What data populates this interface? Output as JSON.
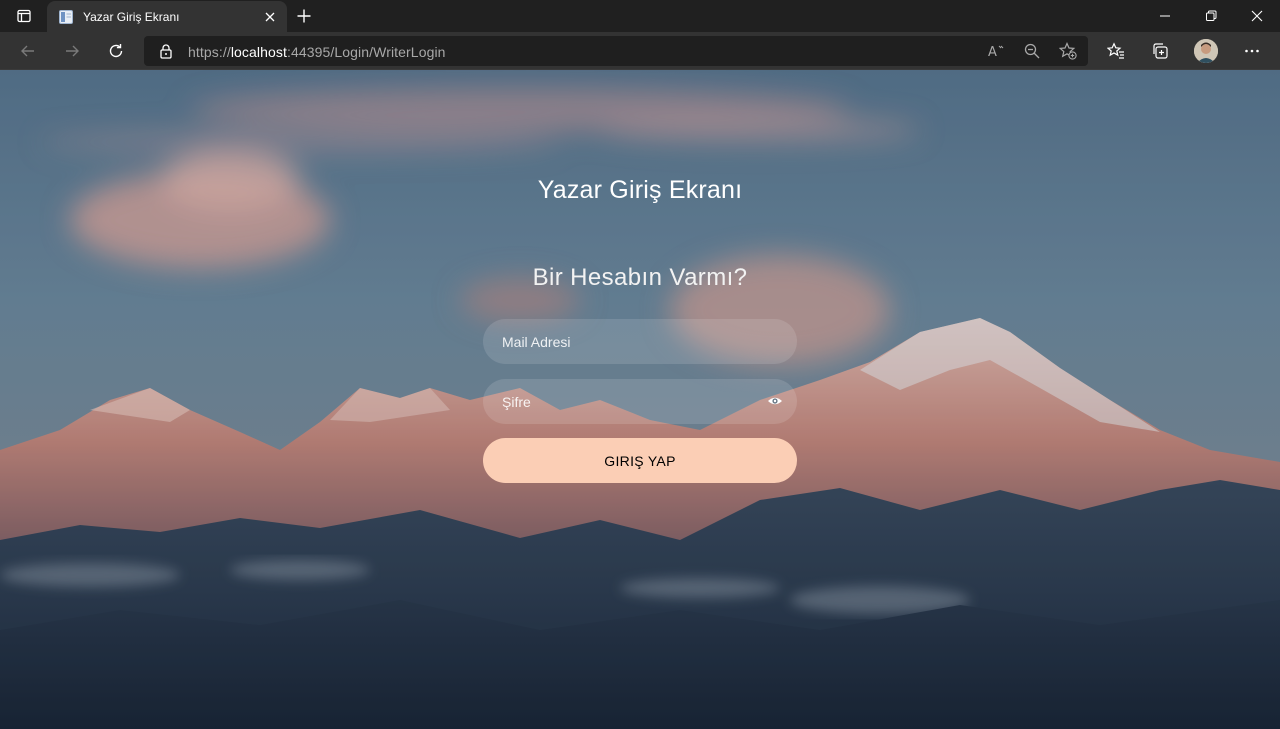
{
  "browser": {
    "tab_title": "Yazar Giriş Ekranı",
    "url_scheme": "https://",
    "url_host": "localhost",
    "url_rest": ":44395/Login/WriterLogin",
    "icons": {
      "tab_actions": "tab-actions-icon",
      "favicon": "page-favicon-icon",
      "tab_close": "close-icon",
      "new_tab": "plus-icon",
      "back": "arrow-left-icon",
      "forward": "arrow-right-icon",
      "refresh": "refresh-icon",
      "lock": "lock-icon",
      "read_aloud": "read-aloud-icon",
      "zoom": "zoom-out-icon",
      "add_favorite": "star-add-icon",
      "favorites": "favorites-icon",
      "collections": "collections-icon",
      "profile": "avatar",
      "menu": "more-icon",
      "minimize": "minimize-icon",
      "restore": "restore-icon",
      "close_window": "close-icon"
    }
  },
  "login": {
    "title": "Yazar Giriş Ekranı",
    "subtitle": "Bir Hesabın Varmı?",
    "mail_placeholder": "Mail Adresi",
    "mail_value": "",
    "password_placeholder": "Şifre",
    "password_value": "",
    "submit_label": "GIRIŞ YAP",
    "submit_color": "#fbceb5"
  }
}
